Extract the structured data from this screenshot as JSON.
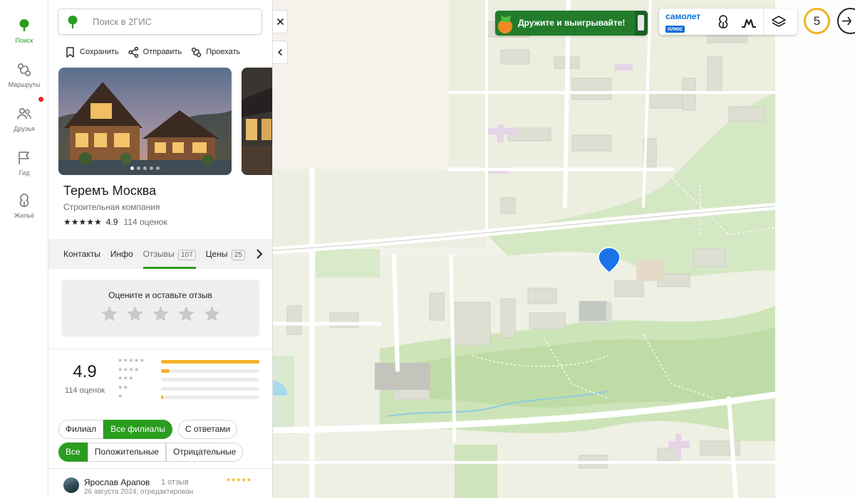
{
  "nav": {
    "items": [
      {
        "label": "Поиск",
        "icon": "search-logo-icon",
        "active": true
      },
      {
        "label": "Маршруты",
        "icon": "routes-icon"
      },
      {
        "label": "Друзья",
        "icon": "friends-icon",
        "has_dot": true
      },
      {
        "label": "Гид",
        "icon": "guide-flag-icon"
      },
      {
        "label": "Жильё",
        "icon": "housing-icon"
      }
    ]
  },
  "search": {
    "placeholder": "Поиск в 2ГИС",
    "value": ""
  },
  "actions": {
    "save": "Сохранить",
    "share": "Отправить",
    "route": "Проехать"
  },
  "company": {
    "name": "Теремъ Москва",
    "category": "Строительная компания",
    "rating": "4.9",
    "reviews_count": "114 оценок",
    "rating_stars": "★★★★★"
  },
  "gallery": {
    "photo_count": 5,
    "active_index": 0
  },
  "tabs": [
    {
      "label": "Контакты"
    },
    {
      "label": "Инфо"
    },
    {
      "label": "Отзывы",
      "badge": "107",
      "active": true
    },
    {
      "label": "Цены",
      "badge": "25"
    }
  ],
  "rate_prompt": {
    "title": "Оцените и оставьте отзыв",
    "stars": 5
  },
  "summary": {
    "rating": "4.9",
    "count": "114 оценок",
    "distribution": [
      {
        "stars": "★★★★★",
        "share": 1.0
      },
      {
        "stars": "★★★★",
        "share": 0.09
      },
      {
        "stars": "★★★",
        "share": 0
      },
      {
        "stars": "★★",
        "share": 0
      },
      {
        "stars": "★",
        "share": 0.02
      }
    ]
  },
  "filters": {
    "scope": [
      "Филиал",
      "Все филиалы",
      "С ответами"
    ],
    "scope_active": "Все филиалы",
    "sentiment": [
      "Все",
      "Положительные",
      "Отрицательные"
    ],
    "sentiment_active": "Все"
  },
  "review": {
    "author": "Ярослав Арапов",
    "author_reviews": "1 отзыв",
    "stars": "★★★★★",
    "date": "26 августа 2024, отредактирован"
  },
  "promo": {
    "text": "Дружите и выигрывайте!"
  },
  "map_controls": {
    "partner_logo_line1": "самолет",
    "partner_logo_line2": "плюс",
    "buttons": [
      "housing-icon",
      "metro-icon",
      "layers-icon"
    ]
  },
  "weather": {
    "value": "5"
  },
  "colors": {
    "accent": "#2a9d1e",
    "star": "#f3b325",
    "pin": "#1a73e8"
  }
}
